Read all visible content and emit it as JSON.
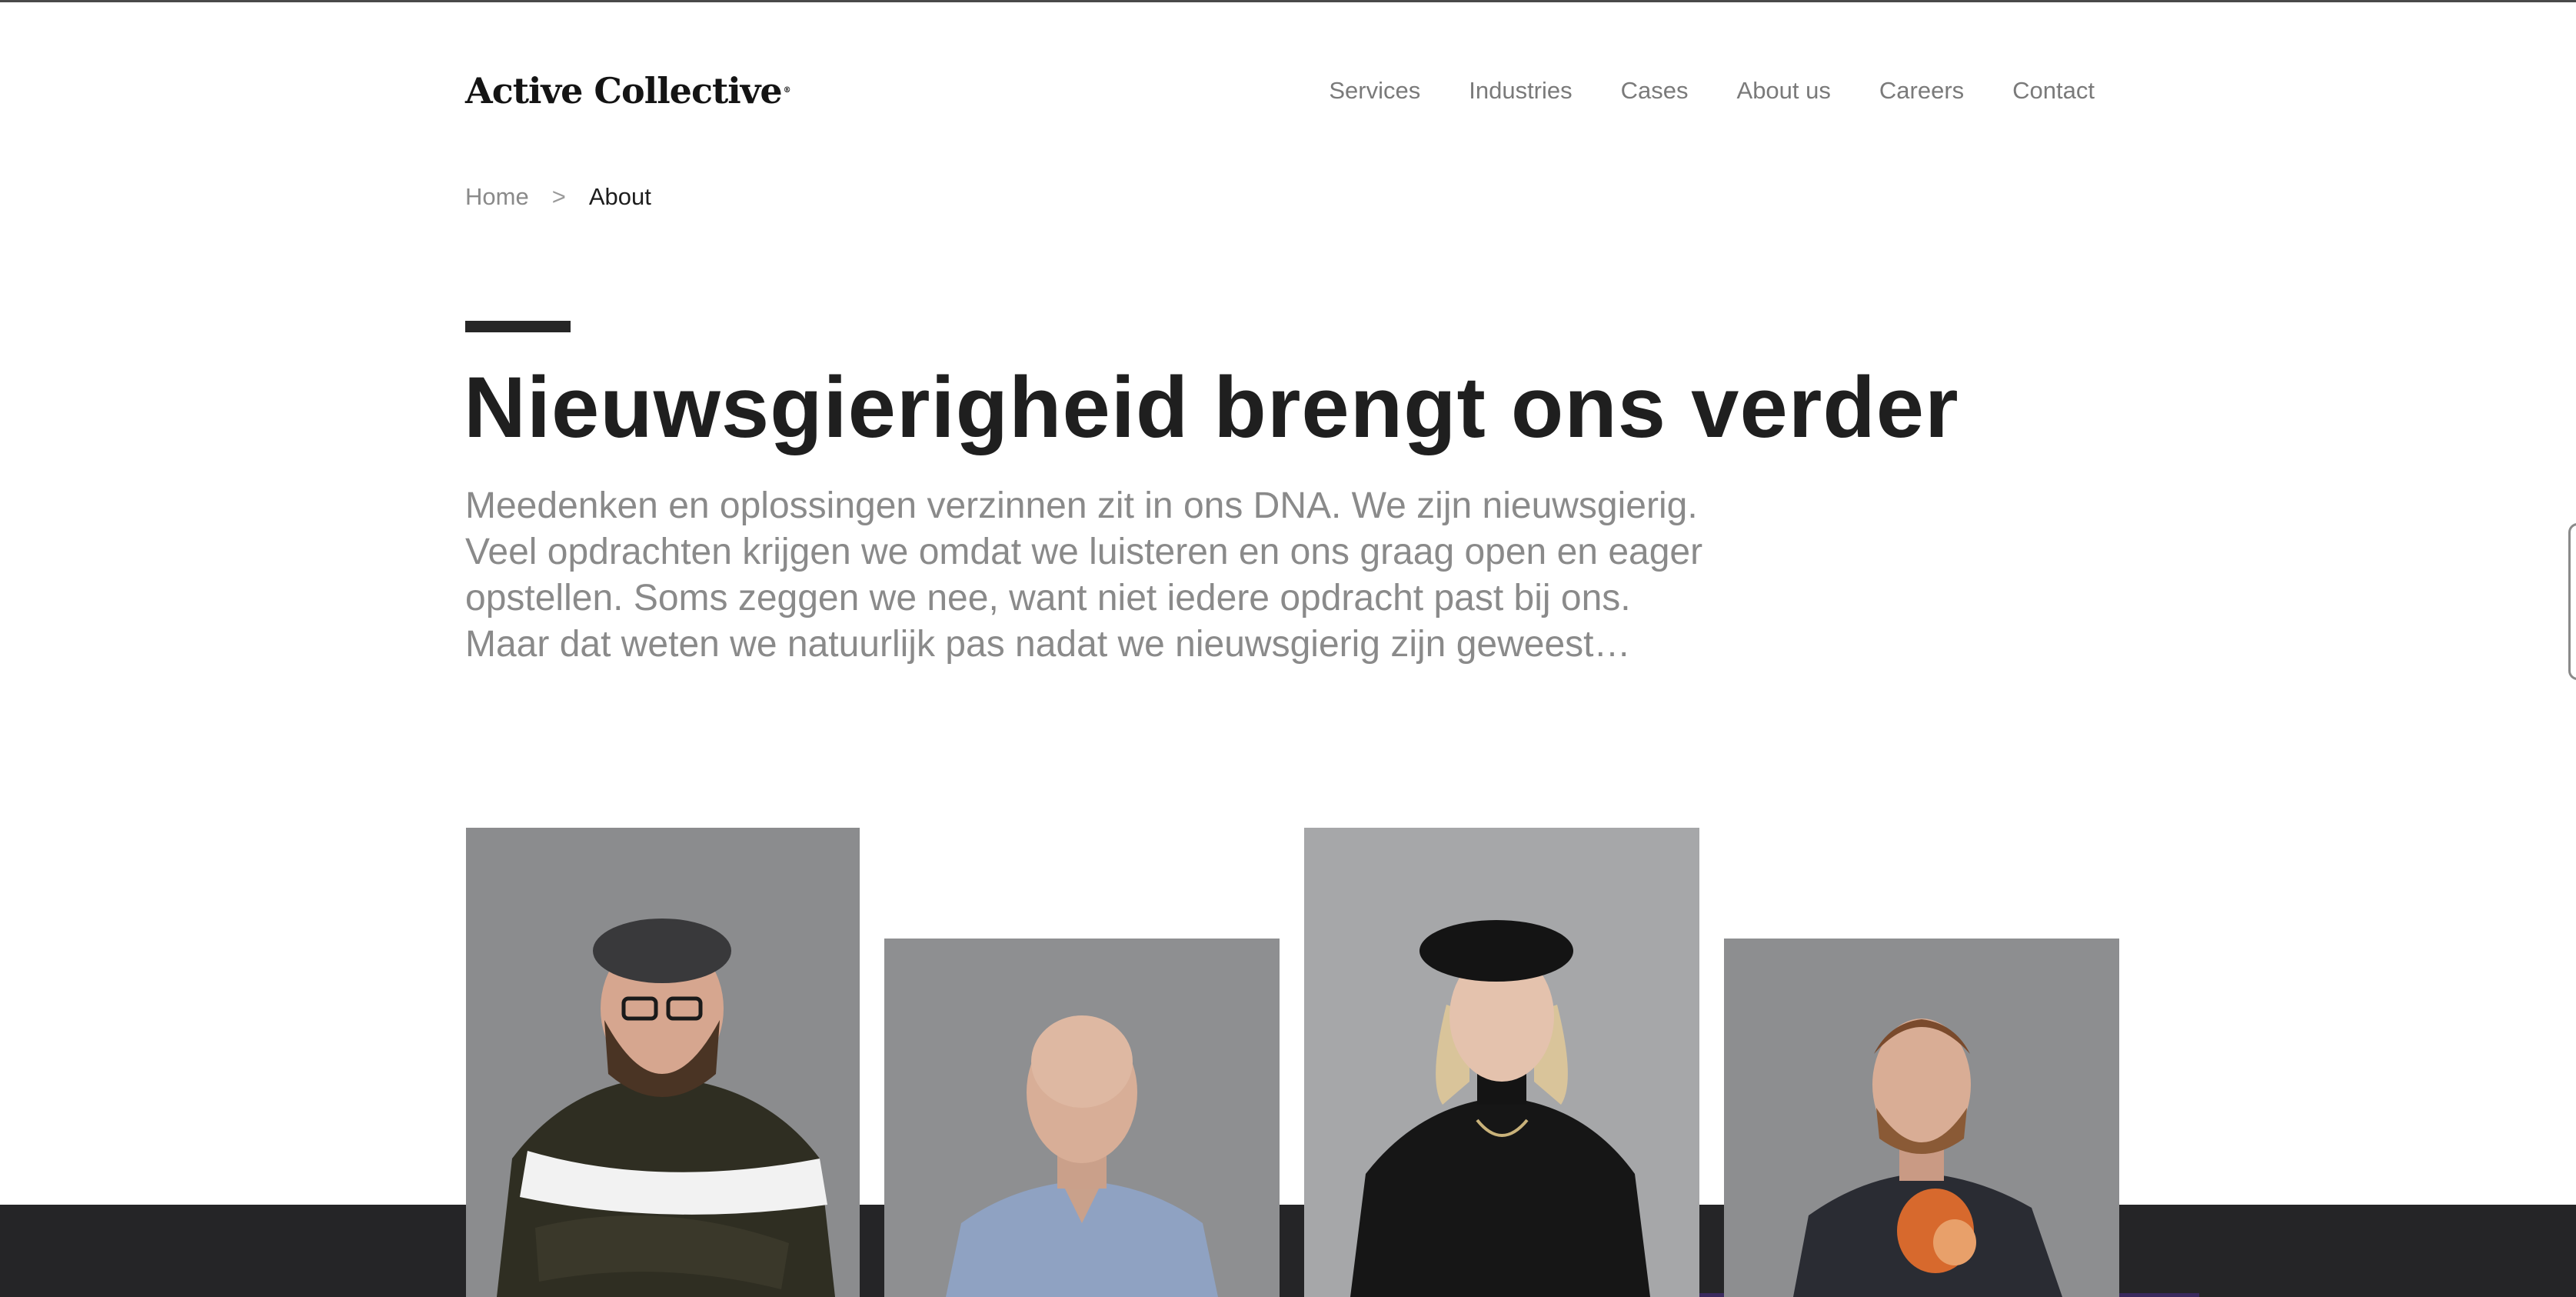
{
  "header": {
    "logo_text": "Active Collective",
    "logo_mark": "®",
    "nav": [
      {
        "label": "Services"
      },
      {
        "label": "Industries"
      },
      {
        "label": "Cases"
      },
      {
        "label": "About us"
      },
      {
        "label": "Careers"
      },
      {
        "label": "Contact"
      }
    ]
  },
  "breadcrumb": {
    "home": "Home",
    "separator": ">",
    "current": "About"
  },
  "hero": {
    "title": "Nieuwsgierigheid brengt ons verder",
    "intro_lines": [
      "Meedenken en oplossingen verzinnen zit in ons DNA. We zijn nieuwsgierig.",
      "Veel opdrachten krijgen we omdat we luisteren en ons graag open en eager",
      "opstellen. Soms zeggen we nee, want niet iedere opdracht past bij ons.",
      "Maar dat weten we natuurlijk pas nadat we nieuwsgierig zijn geweest…"
    ]
  },
  "team": {
    "portraits": [
      {
        "subject": "man-with-flat-cap-and-glasses"
      },
      {
        "subject": "bald-man-in-denim-shirt"
      },
      {
        "subject": "woman-with-black-beret"
      },
      {
        "subject": "man-holding-object"
      }
    ]
  },
  "colors": {
    "text_dark": "#1f1f1f",
    "text_muted": "#8a8a8a",
    "footer_band": "#252527",
    "photo_bg": "#8c8d8f"
  }
}
